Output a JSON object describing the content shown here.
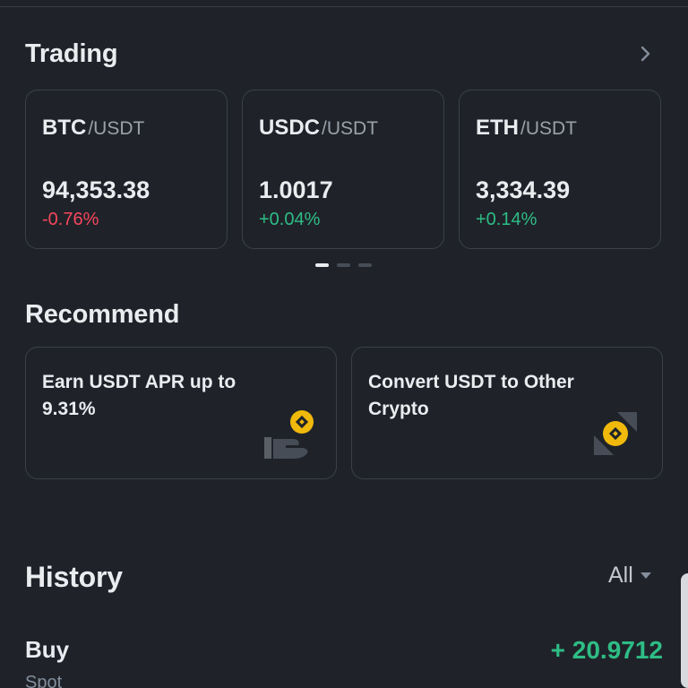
{
  "trading": {
    "title": "Trading",
    "pairs": [
      {
        "base": "BTC",
        "quote": "/USDT",
        "price": "94,353.38",
        "change": "-0.76%"
      },
      {
        "base": "USDC",
        "quote": "/USDT",
        "price": "1.0017",
        "change": "+0.04%"
      },
      {
        "base": "ETH",
        "quote": "/USDT",
        "price": "3,334.39",
        "change": "+0.14%"
      }
    ],
    "pager": {
      "pages": 3,
      "active": 1
    }
  },
  "recommend": {
    "title": "Recommend",
    "items": [
      {
        "text": "Earn USDT APR up to 9.31%",
        "icon": "earn-coin-hand-icon"
      },
      {
        "text": "Convert USDT to Other Crypto",
        "icon": "convert-coin-icon"
      }
    ]
  },
  "history": {
    "title": "History",
    "filter": "All",
    "entries": [
      {
        "type": "Buy",
        "sub": "Spot",
        "amount": "+ 20.9712"
      }
    ]
  },
  "colors": {
    "background": "#1f2329",
    "positive": "#2ebd85",
    "negative": "#f6465d",
    "accent": "#f0b90b"
  }
}
